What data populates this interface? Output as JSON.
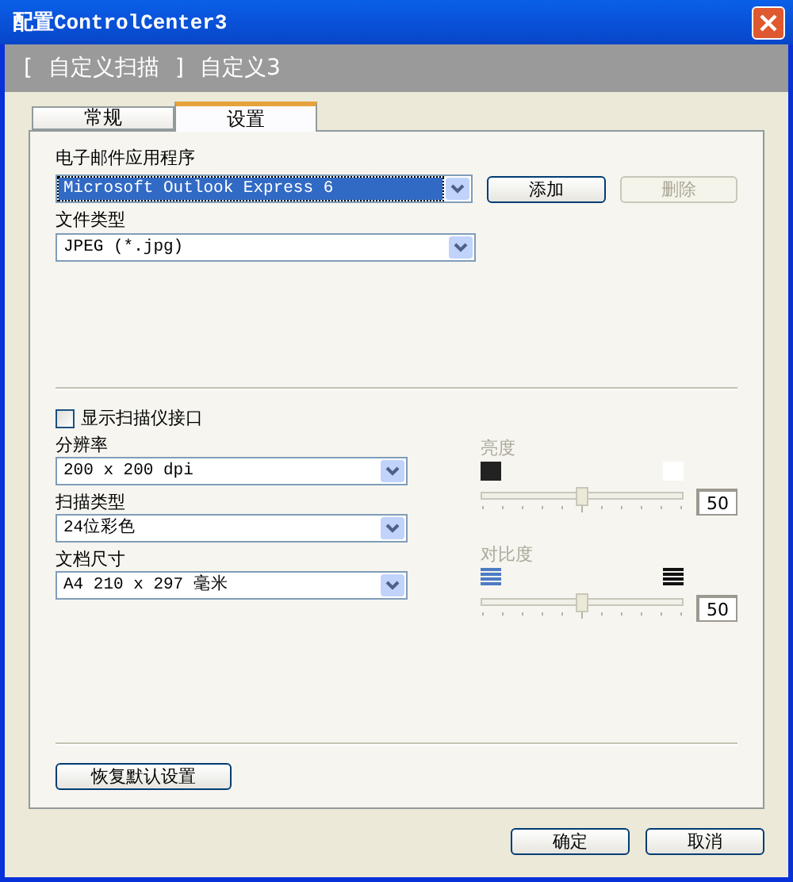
{
  "window": {
    "title": "配置ControlCenter3"
  },
  "header": {
    "bracket_open": "[",
    "section": "自定义扫描",
    "bracket_close": "]",
    "name": "自定义3"
  },
  "tabs": [
    {
      "label": "常规",
      "selected": false
    },
    {
      "label": "设置",
      "selected": true
    }
  ],
  "email_app": {
    "label": "电子邮件应用程序",
    "value": "Microsoft Outlook Express 6",
    "highlighted": true
  },
  "email_buttons": [
    {
      "label": "添加",
      "disabled": false
    },
    {
      "label": "删除",
      "disabled": true
    }
  ],
  "file_type": {
    "label": "文件类型",
    "value": "JPEG (*.jpg)"
  },
  "show_scanner_interface": {
    "label": "显示扫描仪接口",
    "checked": false
  },
  "left_fields": [
    {
      "label": "分辨率",
      "value": "200 x 200 dpi"
    },
    {
      "label": "扫描类型",
      "value": "24位彩色"
    },
    {
      "label": "文档尺寸",
      "value": "A4 210 x 297 毫米"
    }
  ],
  "sliders": [
    {
      "kind": "brightness",
      "label": "亮度",
      "disabled": true,
      "level": 0.5,
      "reading": "50"
    },
    {
      "kind": "contrast",
      "label": "对比度",
      "disabled": true,
      "level": 0.5,
      "reading": "50"
    }
  ],
  "reset_button": "恢复默认设置",
  "dialog_buttons": [
    "确定",
    "取消"
  ]
}
